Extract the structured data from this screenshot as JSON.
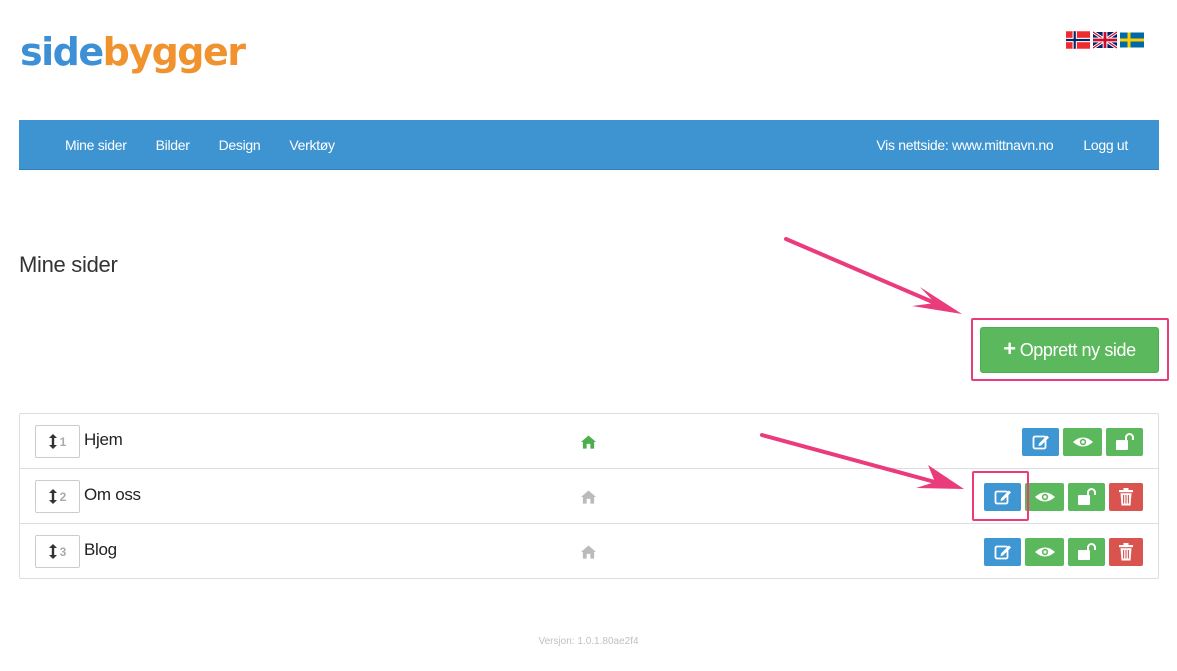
{
  "brand": {
    "part1": "side",
    "part2": "bygger"
  },
  "languages": [
    {
      "name": "norwegian-flag"
    },
    {
      "name": "uk-flag"
    },
    {
      "name": "swedish-flag"
    }
  ],
  "nav": {
    "left": [
      "Mine sider",
      "Bilder",
      "Design",
      "Verktøy"
    ],
    "right": [
      "Vis nettside: www.mittnavn.no",
      "Logg ut"
    ]
  },
  "page": {
    "title": "Mine sider",
    "create_label": "Opprett ny side"
  },
  "pages": [
    {
      "order": "1",
      "name": "Hjem",
      "is_home": true,
      "deletable": false
    },
    {
      "order": "2",
      "name": "Om oss",
      "is_home": false,
      "deletable": true
    },
    {
      "order": "3",
      "name": "Blog",
      "is_home": false,
      "deletable": true
    }
  ],
  "footer": {
    "version": "Versjon: 1.0.1.80ae2f4"
  },
  "colors": {
    "primary": "#3d94d0",
    "success": "#5cb85c",
    "danger": "#d9534f",
    "annotation": "#ea3c7c",
    "home_active": "#4cae4c",
    "home_inactive": "#bbbbbb"
  }
}
